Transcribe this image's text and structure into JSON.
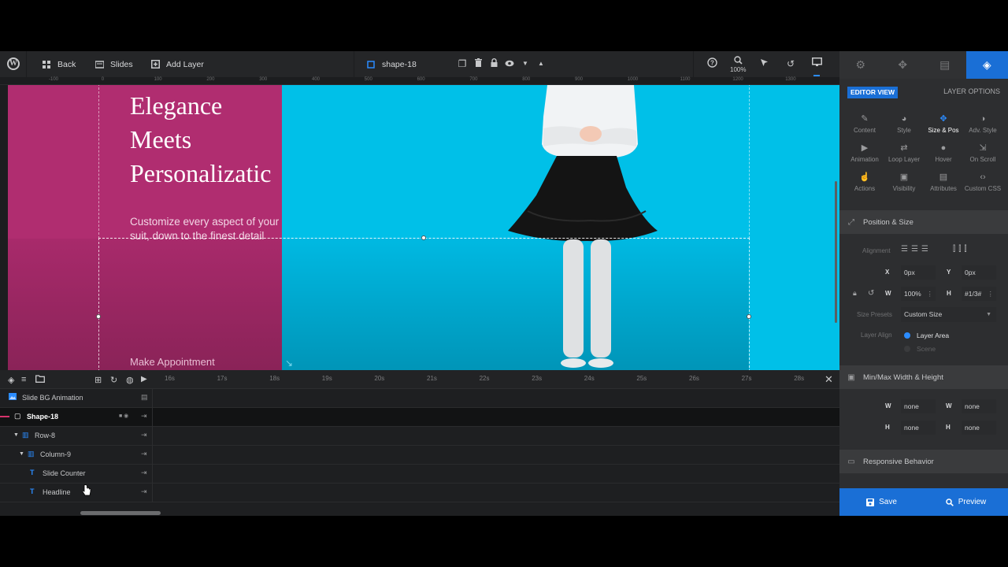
{
  "toolbar": {
    "back_label": "Back",
    "slides_label": "Slides",
    "add_layer_label": "Add Layer",
    "current_layer": "shape-18",
    "zoom_level": "100%"
  },
  "ruler": {
    "ticks": [
      "-100",
      "0",
      "100",
      "200",
      "300",
      "400",
      "500",
      "600",
      "700",
      "800",
      "900",
      "1000",
      "1100",
      "1200",
      "1300"
    ]
  },
  "canvas": {
    "headline_lines": [
      "Elegance",
      "Meets",
      "Personalizatic"
    ],
    "subtext_lines": [
      "Customize every aspect of your",
      "suit, down to the finest detail"
    ],
    "button_text": "Make Appointment",
    "colors": {
      "left_panel": "#b02d70",
      "background": "#00c0e8"
    }
  },
  "sidebar": {
    "editor_view_label": "EDITOR VIEW",
    "layer_options_label": "LAYER OPTIONS",
    "options": [
      {
        "label": "Content",
        "icon": "pencil-icon"
      },
      {
        "label": "Style",
        "icon": "palette-icon"
      },
      {
        "label": "Size & Pos",
        "icon": "move-icon"
      },
      {
        "label": "Adv. Style",
        "icon": "contrast-icon"
      },
      {
        "label": "Animation",
        "icon": "play-icon"
      },
      {
        "label": "Loop Layer",
        "icon": "loop-icon"
      },
      {
        "label": "Hover",
        "icon": "mouse-icon"
      },
      {
        "label": "On Scroll",
        "icon": "scroll-icon"
      },
      {
        "label": "Actions",
        "icon": "hand-pointer-icon"
      },
      {
        "label": "Visibility",
        "icon": "monitor-icon"
      },
      {
        "label": "Attributes",
        "icon": "document-icon"
      },
      {
        "label": "Custom CSS",
        "icon": "code-icon"
      }
    ],
    "active_option": "Size & Pos",
    "position_size": {
      "title": "Position & Size",
      "alignment_label": "Alignment",
      "x_label": "X",
      "x_value": "0px",
      "y_label": "Y",
      "y_value": "0px",
      "w_label": "W",
      "w_value": "100%",
      "h_label": "H",
      "h_value": "#1/3#",
      "size_presets_label": "Size Presets",
      "size_presets_value": "Custom Size",
      "layer_align_label": "Layer Align",
      "layer_align_options": [
        "Layer Area",
        "Scene"
      ],
      "layer_align_selected": "Layer Area"
    },
    "minmax": {
      "title": "Min/Max Width & Height",
      "min_w": "none",
      "max_w": "none",
      "min_h": "none",
      "max_h": "none",
      "w_label": "W",
      "h_label": "H"
    },
    "responsive_title": "Responsive Behavior",
    "save_label": "Save",
    "preview_label": "Preview"
  },
  "timeline": {
    "times": [
      "16s",
      "17s",
      "18s",
      "19s",
      "20s",
      "21s",
      "22s",
      "23s",
      "24s",
      "25s",
      "26s",
      "27s",
      "28s"
    ],
    "layers": [
      {
        "name": "Slide BG Animation"
      },
      {
        "name": "Shape-18"
      },
      {
        "name": "Row-8"
      },
      {
        "name": "Column-9"
      },
      {
        "name": "Slide Counter"
      },
      {
        "name": "Headline"
      }
    ]
  }
}
